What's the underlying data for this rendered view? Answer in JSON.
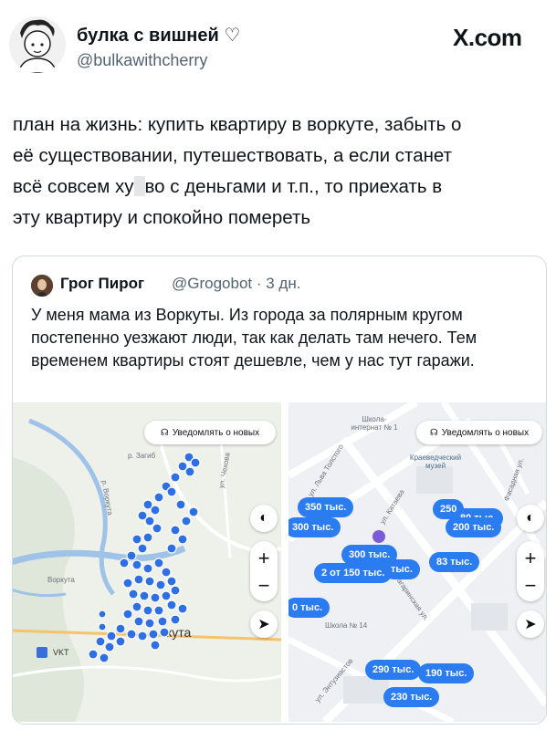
{
  "header": {
    "display_name": "булка с вишней ♡",
    "handle": "@bulkawithcherry",
    "brand": "X.com"
  },
  "tweet": {
    "line1": "план на жизнь: купить квартиру в воркуте, забыть о",
    "line2": "её существовании, путешествовать, а если станет",
    "line3a": "всё совсем ху",
    "line3b": "во с деньгами и т.п., то приехать в",
    "line4": "эту квартиру и спокойно помереть"
  },
  "quoted": {
    "display_name": "Грог Пирог",
    "handle_time": "@Grogobot · 3 дн.",
    "text": "У меня мама из Воркуты. Из города за полярным кругом постепенно уезжают люди, так как делать там нечего. Тем временем квартиры стоят дешевле, чем у нас тут гаражи."
  },
  "map_left": {
    "notify_label": "Уведомлять о новых",
    "labels": {
      "vorkuta": "Воркута",
      "kuta": "кута",
      "vkt": "VKT",
      "zagib": "р. Загиб",
      "river": "р. Воркута",
      "street": "ул. Чехова"
    }
  },
  "map_right": {
    "notify_label": "Уведомлять о новых",
    "labels": {
      "school": "Школа-интернат № 1",
      "museum": "Краеведческий музей",
      "school14": "Школа № 14",
      "tolstogo": "ул. Льва Толстого",
      "kataeva": "ул. Катаева",
      "gagarina": "Гагаринская ул.",
      "fasad": "Фасадная ул.",
      "entuz": "ул. Энтузиастов"
    },
    "prices": [
      "350 тыс.",
      "300 тыс.",
      "300 тыс.",
      "2 от 150 тыс.",
      "тыс.",
      "83 тыс.",
      "250",
      "80 тыс.",
      "200 тыс.",
      "0 тыс.",
      "290 тыс.",
      "190 тыс.",
      "230 тыс."
    ]
  },
  "colors": {
    "accent": "#2a7cf0",
    "cluster": "#2f6fe4",
    "text_secondary": "#536471"
  }
}
